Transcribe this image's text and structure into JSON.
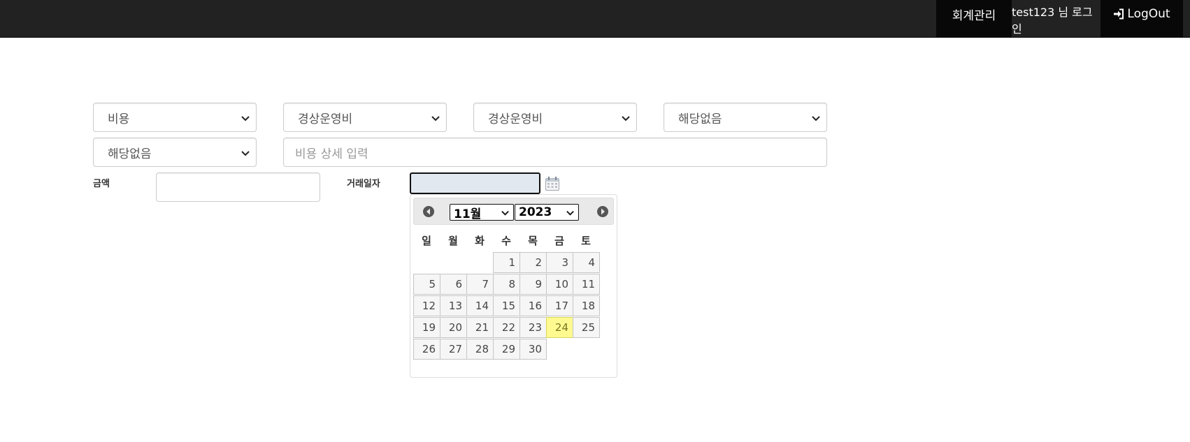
{
  "nav": {
    "accounting": "회계관리",
    "user_greeting": "test123 님 로그인",
    "logout": "LogOut"
  },
  "form": {
    "category_select": "비용",
    "subcategory_select": "경상운영비",
    "item_select": "경상운영비",
    "option_select_1": "해당없음",
    "option_select_2": "해당없음",
    "detail_placeholder": "비용 상세 입력",
    "amount_label": "금액",
    "amount_value": "",
    "date_label": "거래일자",
    "date_value": ""
  },
  "datepicker": {
    "month": "11월",
    "year": "2023",
    "weekdays": [
      "일",
      "월",
      "화",
      "수",
      "목",
      "금",
      "토"
    ],
    "first_weekday_index": 3,
    "days_in_month": 30,
    "days": [
      "1",
      "2",
      "3",
      "4",
      "5",
      "6",
      "7",
      "8",
      "9",
      "10",
      "11",
      "12",
      "13",
      "14",
      "15",
      "16",
      "17",
      "18",
      "19",
      "20",
      "21",
      "22",
      "23",
      "24",
      "25",
      "26",
      "27",
      "28",
      "29",
      "30"
    ],
    "today": "24",
    "today_color": "#fffa90"
  },
  "icons": {
    "logout": "sign-in-icon",
    "calendar": "calendar-icon",
    "prev": "circle-arrow-left-icon",
    "next": "circle-arrow-right-icon"
  }
}
